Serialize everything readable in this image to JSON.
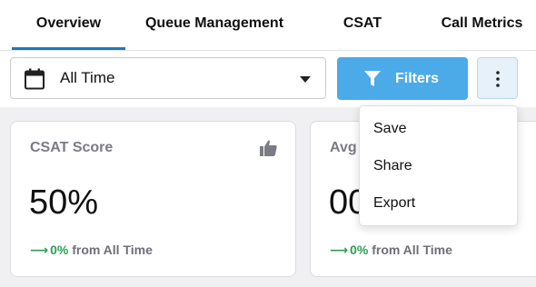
{
  "tabs": [
    {
      "label": "Overview",
      "active": true
    },
    {
      "label": "Queue Management",
      "active": false
    },
    {
      "label": "CSAT",
      "active": false
    },
    {
      "label": "Call Metrics",
      "active": false
    }
  ],
  "date_filter": {
    "label": "All Time",
    "icon": "calendar-icon"
  },
  "filters_button": {
    "label": "Filters",
    "icon": "funnel-icon"
  },
  "more_button": {
    "icon": "kebab-menu-icon"
  },
  "menu": {
    "items": [
      "Save",
      "Share",
      "Export"
    ]
  },
  "cards": [
    {
      "title": "CSAT Score",
      "icon": "thumbs-up-icon",
      "value": "50%",
      "change_pct": "0%",
      "change_suffix": " from All Time"
    },
    {
      "title": "Avg",
      "value": "00",
      "change_pct": "0%",
      "change_suffix": " from All Time"
    }
  ],
  "colors": {
    "accent": "#1e76c4",
    "filters_bg": "#4aabe8",
    "positive": "#2e9e54"
  }
}
